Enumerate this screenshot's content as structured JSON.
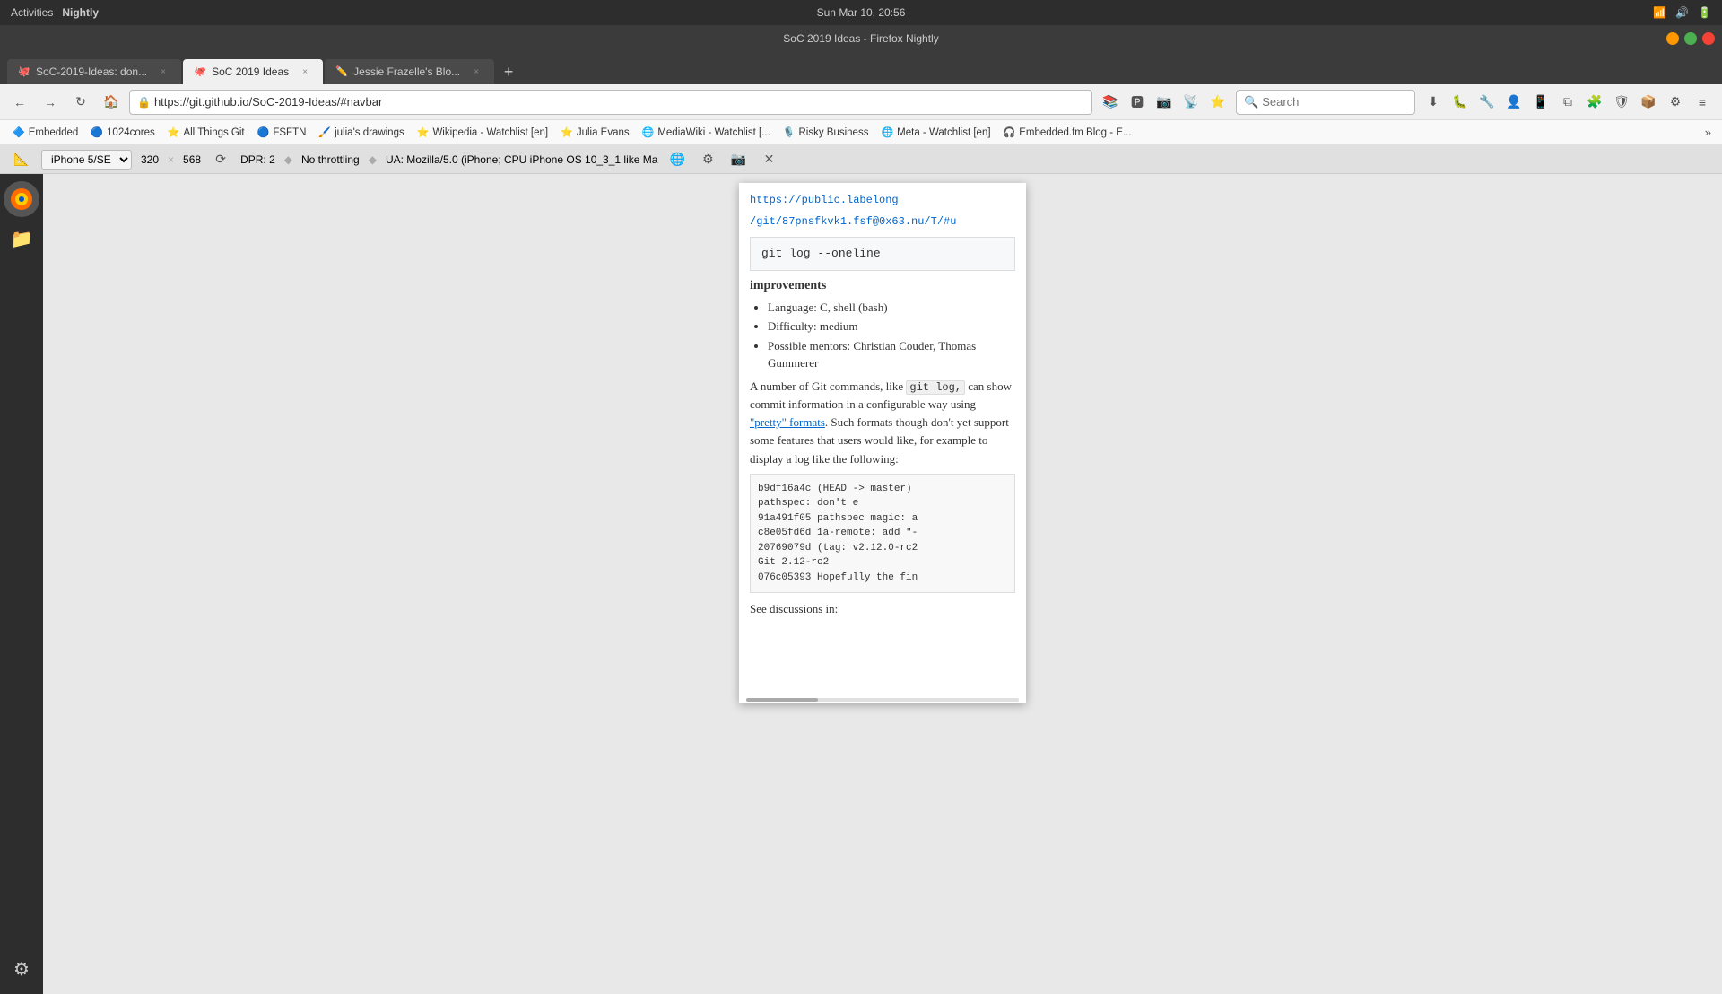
{
  "system": {
    "left_label": "Activities",
    "app_name": "Nightly",
    "clock": "Sun Mar 10, 20:56",
    "window_title": "SoC 2019 Ideas - Firefox Nightly"
  },
  "titlebar": {
    "title": "SoC 2019 Ideas - Firefox Nightly"
  },
  "tabs": [
    {
      "id": "tab1",
      "favicon": "🐙",
      "title": "SoC-2019-Ideas: don...",
      "active": false,
      "closeable": true
    },
    {
      "id": "tab2",
      "favicon": "🐙",
      "title": "SoC 2019 Ideas",
      "active": true,
      "closeable": true
    },
    {
      "id": "tab3",
      "favicon": "✏️",
      "title": "Jessie Frazelle's Blo...",
      "active": false,
      "closeable": true
    }
  ],
  "navbar": {
    "url": "https://git.github.io/SoC-2019-Ideas/#navbar",
    "search_placeholder": "Search"
  },
  "bookmarks": [
    {
      "favicon": "🔷",
      "label": "Embedded"
    },
    {
      "favicon": "🔵",
      "label": "1024cores"
    },
    {
      "favicon": "⭐",
      "label": "All Things Git"
    },
    {
      "favicon": "🔵",
      "label": "FSFTN"
    },
    {
      "favicon": "🖌️",
      "label": "julia's drawings"
    },
    {
      "favicon": "⭐",
      "label": "Wikipedia - Watchlist [en]"
    },
    {
      "favicon": "⭐",
      "label": "Julia Evans"
    },
    {
      "favicon": "🌐",
      "label": "MediaWiki - Watchlist [..."
    },
    {
      "favicon": "🎙️",
      "label": "Risky Business"
    },
    {
      "favicon": "🌐",
      "label": "Meta - Watchlist [en]"
    },
    {
      "favicon": "🎧",
      "label": "Embedded.fm Blog - E..."
    }
  ],
  "device_bar": {
    "device": "iPhone 5/SE",
    "width": "320",
    "height": "568",
    "dpr": "DPR: 2",
    "throttle": "No throttling",
    "ua": "UA: Mozilla/5.0 (iPhone; CPU iPhone OS 10_3_1 like Ma"
  },
  "page": {
    "link_text": "https://public.labelong",
    "link_path": "/git/87pnsfkvk1.fsf@0x63.nu/T/#u",
    "code_heading": "git log --oneline",
    "section": "improvements",
    "bullets": [
      "Language: C, shell (bash)",
      "Difficulty: medium",
      "Possible mentors: Christian Couder, Thomas Gummerer"
    ],
    "body1": "A number of Git commands, like",
    "inline_code": "git log,",
    "body2": "can show commit information in a configurable way using",
    "pretty_link": "\"pretty\" formats",
    "body3": ". Such formats though don't yet support some features that users would like, for example to display a log like the following:",
    "code_lines": [
      "b9df16a4c (HEAD -> master)",
      "              pathspec: don't e",
      "91a491f05 pathspec magic: a",
      "c8e05fd6d 1a-remote: add \"-",
      "20769079d (tag: v2.12.0-rc2",
      "                Git 2.12-rc2",
      "076c05393 Hopefully the fin"
    ],
    "see_discussions": "See discussions in:"
  }
}
